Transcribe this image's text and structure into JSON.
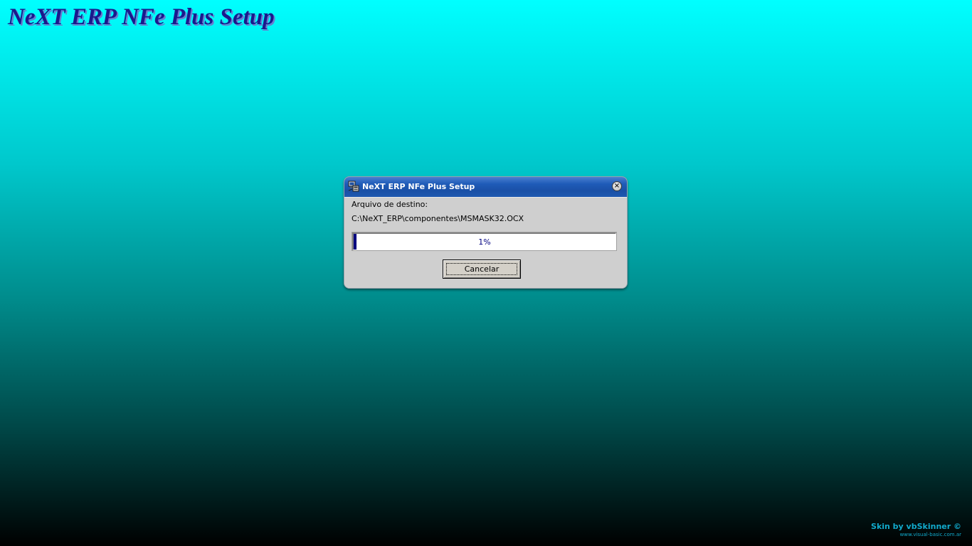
{
  "background": {
    "title": "NeXT ERP NFe Plus Setup"
  },
  "dialog": {
    "title": "NeXT ERP NFe Plus Setup",
    "close_glyph": "×",
    "dest_label": "Arquivo de destino:",
    "dest_path": "C:\\NeXT_ERP\\componentes\\MSMASK32.OCX",
    "progress": {
      "value": 1,
      "text": "1%"
    },
    "cancel_label": "Cancelar"
  },
  "credit": {
    "text": "Skin by vbSkinner ©",
    "url": "www.visual-basic.com.ar"
  },
  "colors": {
    "title_color": "#1a1a8c",
    "titlebar": "#1a50a6",
    "progress_fill": "#000080",
    "credit_color": "#11aacc"
  },
  "icons": {
    "title_icon": "setup-computer-icon",
    "close_icon": "close-icon"
  }
}
